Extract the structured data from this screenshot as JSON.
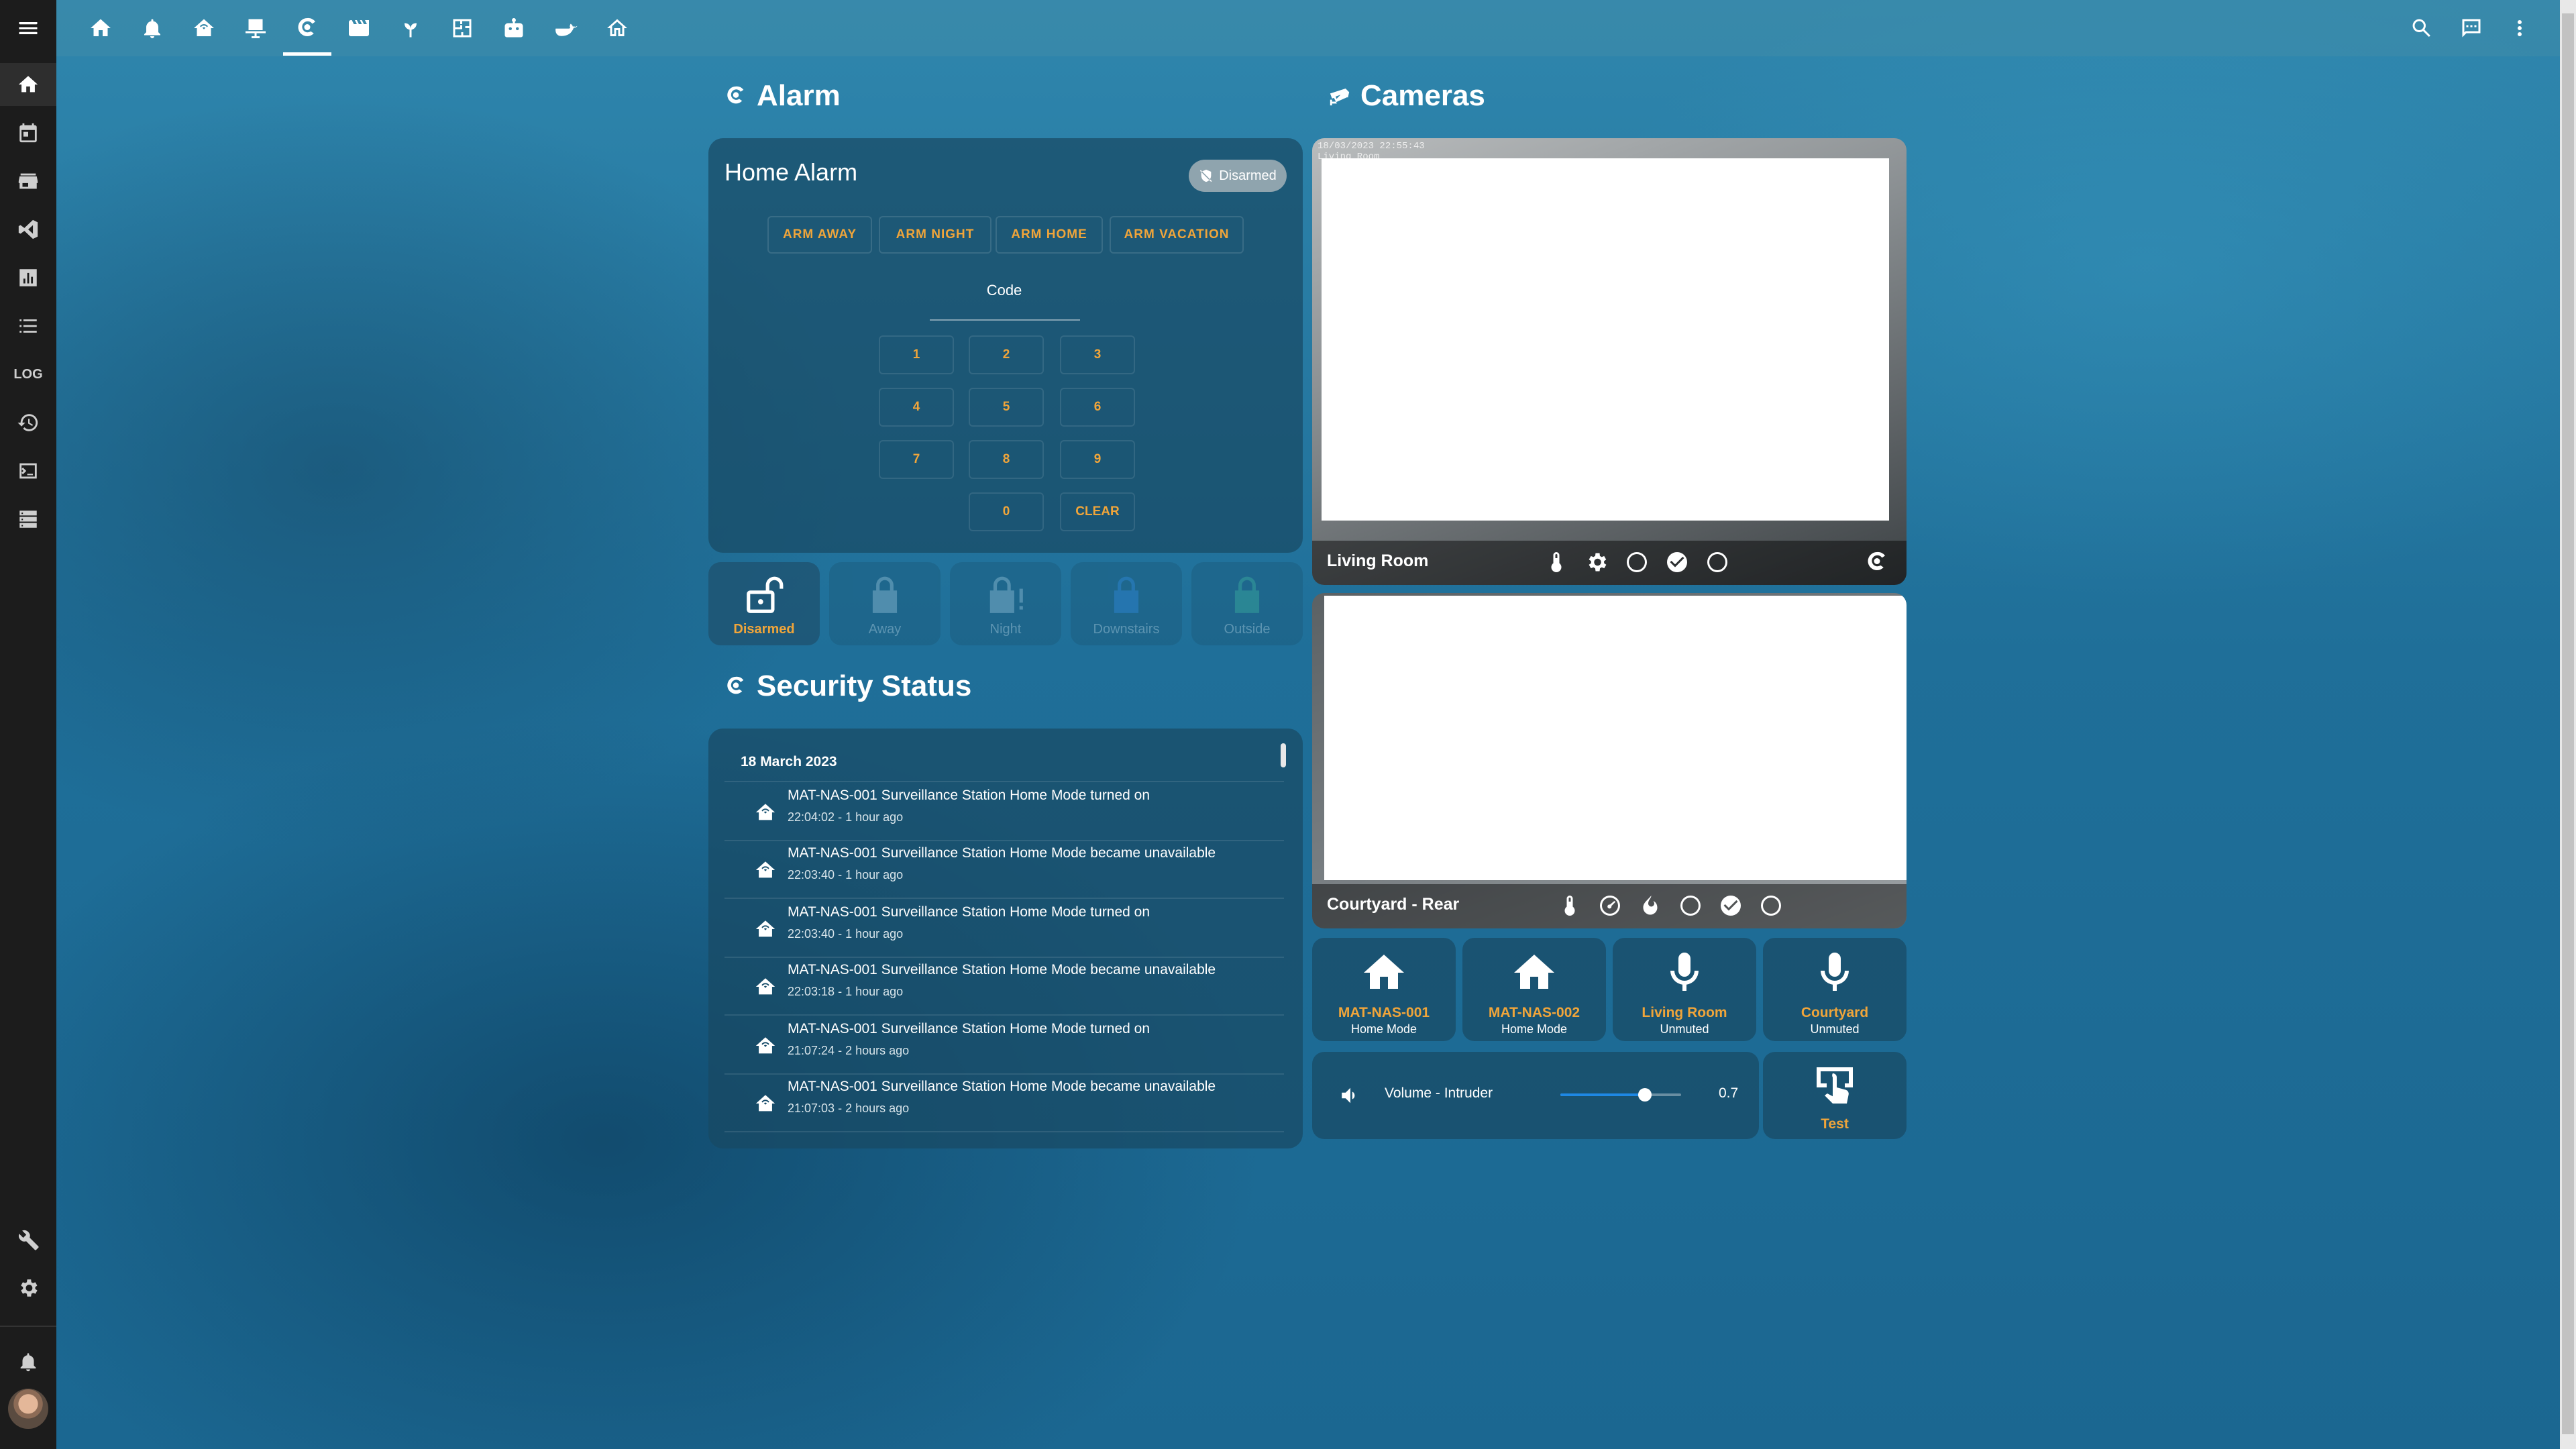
{
  "alarm_section": {
    "title": "Alarm"
  },
  "alarm_panel": {
    "name": "Home Alarm",
    "state_badge": "Disarmed",
    "arm_buttons": [
      "ARM AWAY",
      "ARM NIGHT",
      "ARM HOME",
      "ARM VACATION"
    ],
    "code_label": "Code",
    "keys": [
      "1",
      "2",
      "3",
      "4",
      "5",
      "6",
      "7",
      "8",
      "9",
      "0",
      "CLEAR"
    ]
  },
  "modes": [
    {
      "label": "Disarmed",
      "icon": "lock-open-icon",
      "active": true
    },
    {
      "label": "Away",
      "icon": "lock-icon",
      "active": false
    },
    {
      "label": "Night",
      "icon": "lock-alert-icon",
      "active": false
    },
    {
      "label": "Downstairs",
      "icon": "lock-icon",
      "active": false
    },
    {
      "label": "Outside",
      "icon": "lock-icon",
      "active": false
    }
  ],
  "security_section": {
    "title": "Security Status"
  },
  "logbook": {
    "date": "18 March 2023",
    "entries": [
      {
        "message": "MAT-NAS-001 Surveillance Station Home Mode turned on",
        "time": "22:04:02 - 1 hour ago"
      },
      {
        "message": "MAT-NAS-001 Surveillance Station Home Mode became unavailable",
        "time": "22:03:40 - 1 hour ago"
      },
      {
        "message": "MAT-NAS-001 Surveillance Station Home Mode turned on",
        "time": "22:03:40 - 1 hour ago"
      },
      {
        "message": "MAT-NAS-001 Surveillance Station Home Mode became unavailable",
        "time": "22:03:18 - 1 hour ago"
      },
      {
        "message": "MAT-NAS-001 Surveillance Station Home Mode turned on",
        "time": "21:07:24 - 2 hours ago"
      },
      {
        "message": "MAT-NAS-001 Surveillance Station Home Mode became unavailable",
        "time": "21:07:03 - 2 hours ago"
      }
    ]
  },
  "cameras_section": {
    "title": "Cameras"
  },
  "cameras": [
    {
      "name": "Living Room",
      "overlay_timestamp": "18/03/2023 22:55:43",
      "overlay_label": "Living Room"
    },
    {
      "name": "Courtyard - Rear"
    }
  ],
  "entity_tiles": [
    {
      "name": "MAT-NAS-001",
      "state": "Home Mode",
      "icon": "home-icon"
    },
    {
      "name": "MAT-NAS-002",
      "state": "Home Mode",
      "icon": "home-icon"
    },
    {
      "name": "Living Room",
      "state": "Unmuted",
      "icon": "microphone-icon"
    },
    {
      "name": "Courtyard",
      "state": "Unmuted",
      "icon": "microphone-icon"
    }
  ],
  "volume": {
    "label": "Volume - Intruder",
    "value": "0.7",
    "level_fraction": 0.7
  },
  "test_button": {
    "label": "Test"
  },
  "colors": {
    "accent": "#f0a53a",
    "card": "#184862",
    "sidebar": "#1c1c1c"
  }
}
